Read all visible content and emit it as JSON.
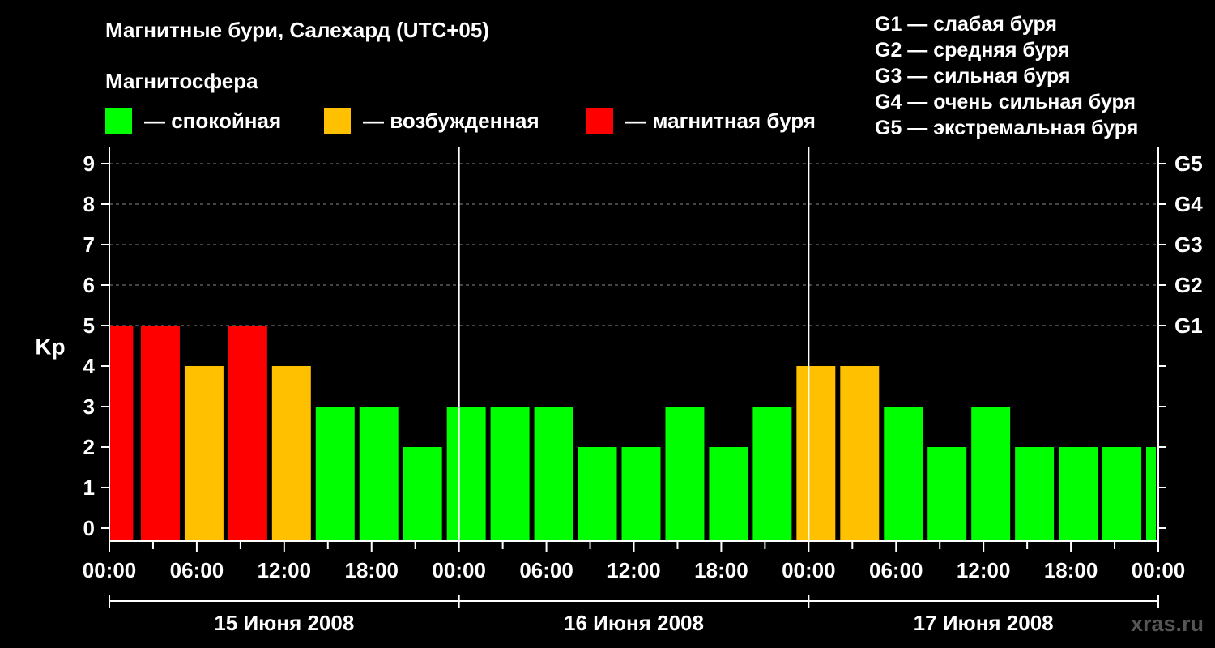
{
  "title": "Магнитные бури, Салехард (UTC+05)",
  "subtitle": "Магнитосфера",
  "legend": [
    {
      "color": "#00ff00",
      "label": "— спокойная"
    },
    {
      "color": "#ffc000",
      "label": "— возбужденная"
    },
    {
      "color": "#ff0000",
      "label": "— магнитная буря"
    }
  ],
  "g_legend": [
    "G1 — слабая буря",
    "G2 — средняя буря",
    "G3 — сильная буря",
    "G4 — очень сильная буря",
    "G5 — экстремальная буря"
  ],
  "watermark": "xras.ru",
  "chart_data": {
    "type": "bar",
    "ylabel": "Kp",
    "ylim": [
      0,
      9
    ],
    "yticks": [
      "0",
      "1",
      "2",
      "3",
      "4",
      "5",
      "6",
      "7",
      "8",
      "9"
    ],
    "right_axis_labels": [
      {
        "kp": 5,
        "label": "G1"
      },
      {
        "kp": 6,
        "label": "G2"
      },
      {
        "kp": 7,
        "label": "G3"
      },
      {
        "kp": 8,
        "label": "G4"
      },
      {
        "kp": 9,
        "label": "G5"
      }
    ],
    "xtick_labels": [
      "00:00",
      "06:00",
      "12:00",
      "18:00",
      "00:00",
      "06:00",
      "12:00",
      "18:00",
      "00:00",
      "06:00",
      "12:00",
      "18:00",
      "00:00"
    ],
    "days": [
      "15 Июня 2008",
      "16 Июня 2008",
      "17 Июня 2008"
    ],
    "colors": {
      "quiet": "#00ff00",
      "active": "#ffc000",
      "storm": "#ff0000"
    },
    "bars": [
      {
        "start_hour": 0,
        "end_hour": 1.8,
        "kp": 5,
        "level": "storm"
      },
      {
        "start_hour": 2,
        "end_hour": 5,
        "kp": 5,
        "level": "storm"
      },
      {
        "start_hour": 5,
        "end_hour": 8,
        "kp": 4,
        "level": "active"
      },
      {
        "start_hour": 8,
        "end_hour": 11,
        "kp": 5,
        "level": "storm"
      },
      {
        "start_hour": 11,
        "end_hour": 14,
        "kp": 4,
        "level": "active"
      },
      {
        "start_hour": 14,
        "end_hour": 17,
        "kp": 3,
        "level": "quiet"
      },
      {
        "start_hour": 17,
        "end_hour": 20,
        "kp": 3,
        "level": "quiet"
      },
      {
        "start_hour": 20,
        "end_hour": 23,
        "kp": 2,
        "level": "quiet"
      },
      {
        "start_hour": 23,
        "end_hour": 26,
        "kp": 3,
        "level": "quiet"
      },
      {
        "start_hour": 26,
        "end_hour": 29,
        "kp": 3,
        "level": "quiet"
      },
      {
        "start_hour": 29,
        "end_hour": 32,
        "kp": 3,
        "level": "quiet"
      },
      {
        "start_hour": 32,
        "end_hour": 35,
        "kp": 2,
        "level": "quiet"
      },
      {
        "start_hour": 35,
        "end_hour": 38,
        "kp": 2,
        "level": "quiet"
      },
      {
        "start_hour": 38,
        "end_hour": 41,
        "kp": 3,
        "level": "quiet"
      },
      {
        "start_hour": 41,
        "end_hour": 44,
        "kp": 2,
        "level": "quiet"
      },
      {
        "start_hour": 44,
        "end_hour": 47,
        "kp": 3,
        "level": "quiet"
      },
      {
        "start_hour": 47,
        "end_hour": 50,
        "kp": 4,
        "level": "active"
      },
      {
        "start_hour": 50,
        "end_hour": 53,
        "kp": 4,
        "level": "active"
      },
      {
        "start_hour": 53,
        "end_hour": 56,
        "kp": 3,
        "level": "quiet"
      },
      {
        "start_hour": 56,
        "end_hour": 59,
        "kp": 2,
        "level": "quiet"
      },
      {
        "start_hour": 59,
        "end_hour": 62,
        "kp": 3,
        "level": "quiet"
      },
      {
        "start_hour": 62,
        "end_hour": 65,
        "kp": 2,
        "level": "quiet"
      },
      {
        "start_hour": 65,
        "end_hour": 68,
        "kp": 2,
        "level": "quiet"
      },
      {
        "start_hour": 68,
        "end_hour": 71,
        "kp": 2,
        "level": "quiet"
      },
      {
        "start_hour": 71,
        "end_hour": 72,
        "kp": 2,
        "level": "quiet"
      }
    ]
  }
}
